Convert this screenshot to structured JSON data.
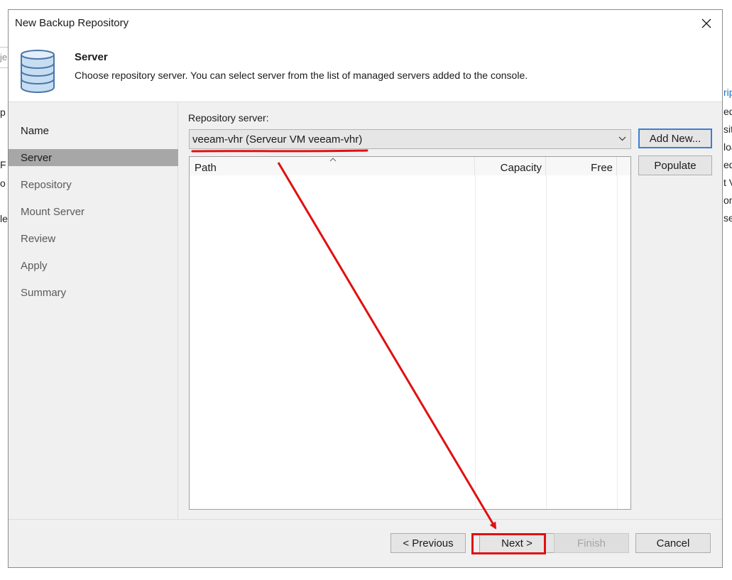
{
  "background": {
    "left_fragments": [
      "je",
      "p",
      "F",
      "o F",
      "le"
    ],
    "right_fragments": [
      "ript",
      "ed",
      "site",
      "loa",
      "ed",
      "t V",
      "om",
      "se"
    ]
  },
  "dialog": {
    "title": "New Backup Repository",
    "close_icon": "close-icon"
  },
  "header": {
    "icon": "database-icon",
    "title": "Server",
    "description": "Choose repository server. You can select server from the list of managed servers added to the console."
  },
  "nav": {
    "items": [
      {
        "label": "Name"
      },
      {
        "label": "Server"
      },
      {
        "label": "Repository"
      },
      {
        "label": "Mount Server"
      },
      {
        "label": "Review"
      },
      {
        "label": "Apply"
      },
      {
        "label": "Summary"
      }
    ],
    "active": "Server"
  },
  "content": {
    "repository_label": "Repository server:",
    "selected_server": "veeam-vhr (Serveur VM veeam-vhr)",
    "add_new_label": "Add New...",
    "populate_label": "Populate",
    "table": {
      "columns": [
        "Path",
        "Capacity",
        "Free"
      ],
      "rows": []
    }
  },
  "footer": {
    "previous_label": "< Previous",
    "next_label": "Next >",
    "finish_label": "Finish",
    "cancel_label": "Cancel"
  },
  "colors": {
    "annotation": "#e01010",
    "default_button_border": "#3c7fd0",
    "active_nav": "#a7a7a7"
  }
}
